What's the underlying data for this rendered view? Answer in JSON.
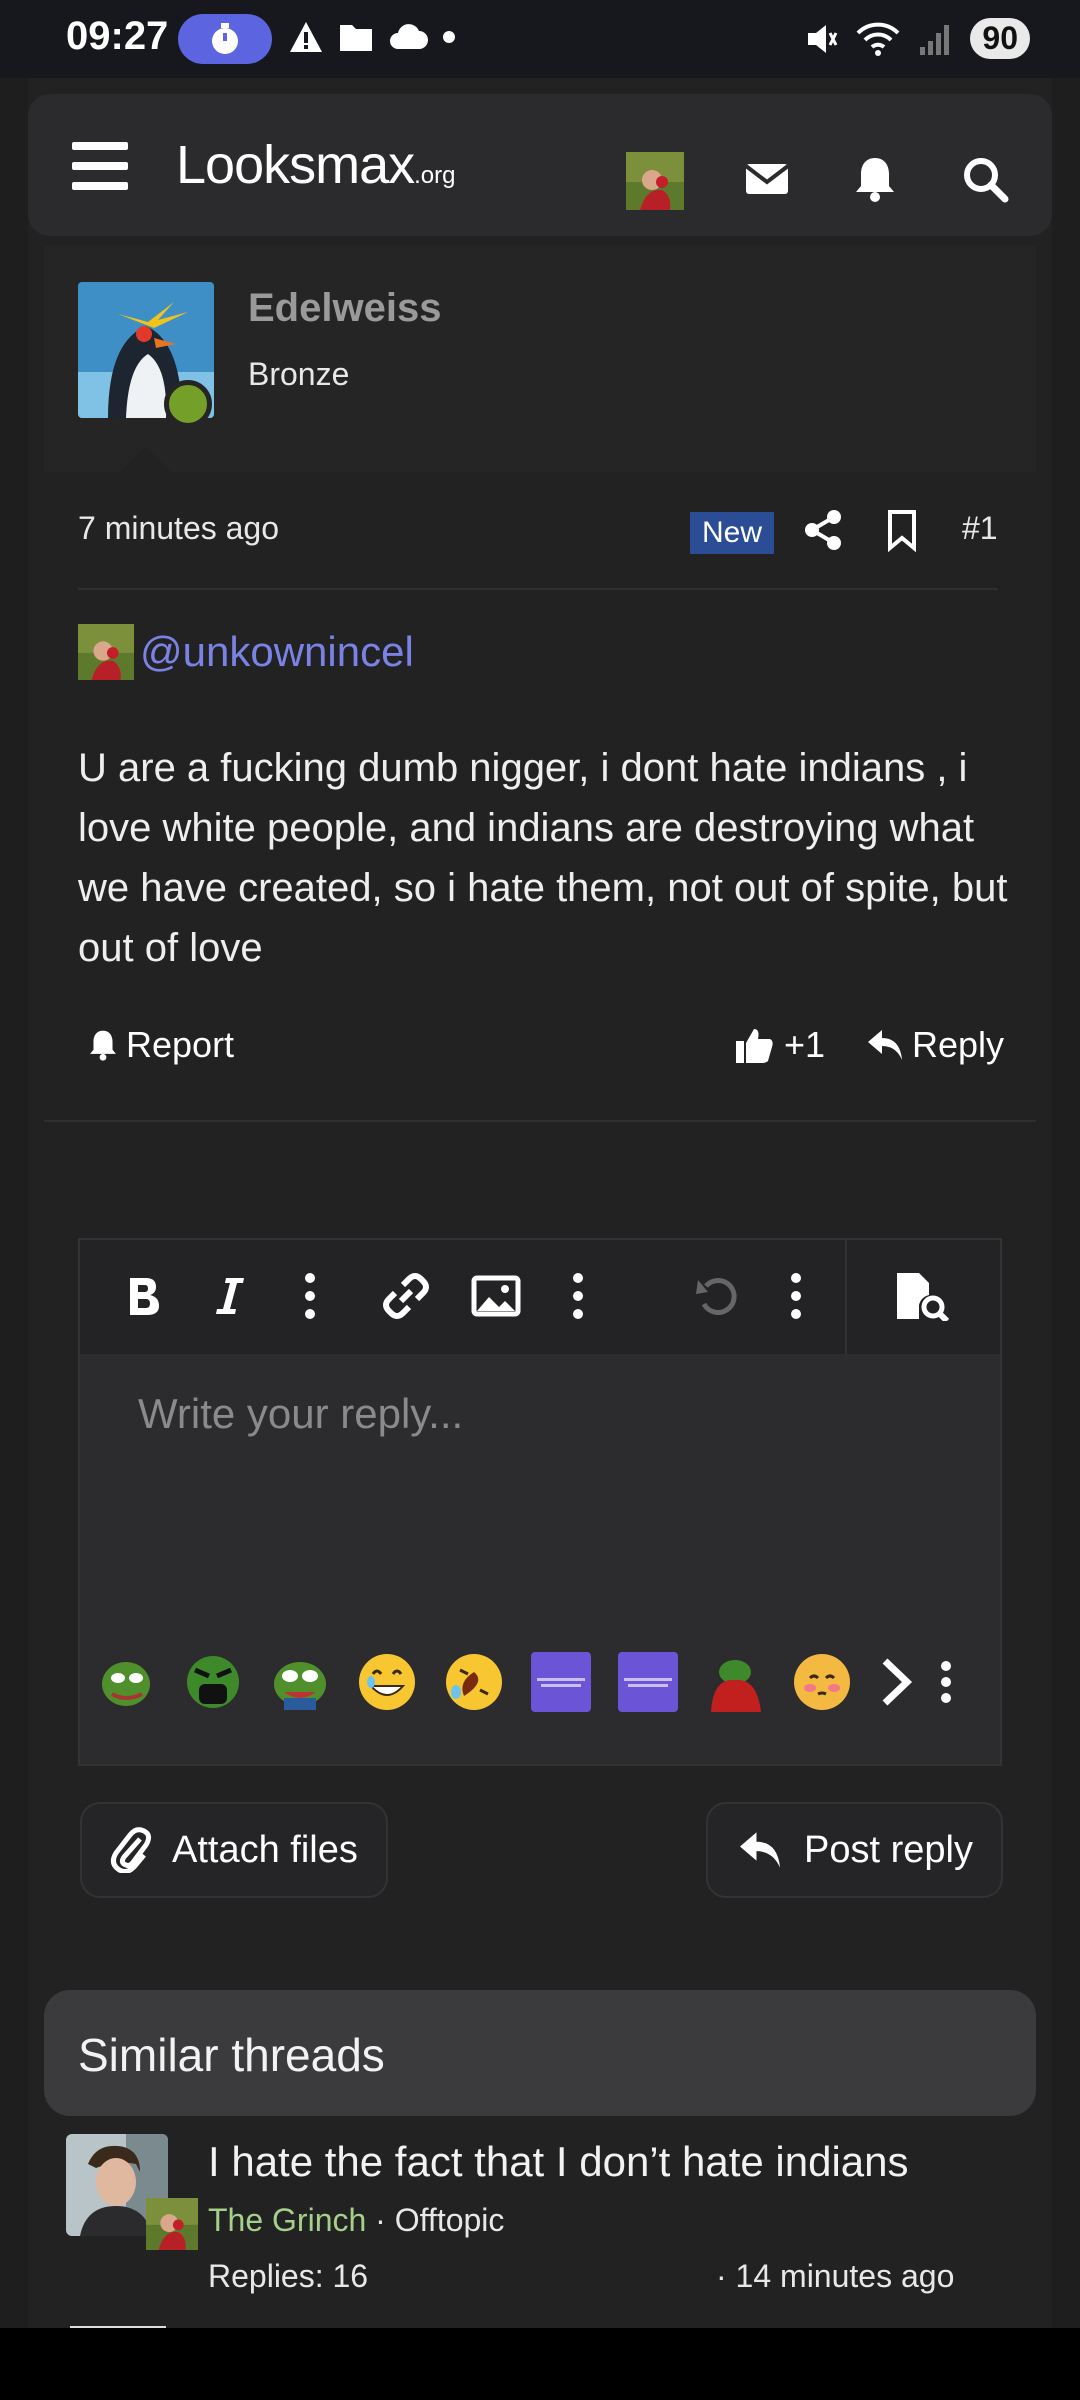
{
  "status_bar": {
    "time": "09:27",
    "battery": "90"
  },
  "header": {
    "logo_main": "Looksmax",
    "logo_suffix": ".org"
  },
  "post": {
    "author_name": "Edelweiss",
    "author_rank": "Bronze",
    "time": "7 minutes ago",
    "badge": "New",
    "post_number": "#1",
    "mention": "@unkownincel",
    "body": "U are a fucking dumb nigger, i dont hate indians , i love white people, and indians are destroying what we have created, so i hate them, not out of spite, but out of love",
    "report_label": "Report",
    "likes": "+1",
    "reply_label": "Reply"
  },
  "editor": {
    "placeholder": "Write your reply...",
    "attach_label": "Attach files",
    "post_reply_label": "Post reply"
  },
  "similar": {
    "title": "Similar threads",
    "threads": [
      {
        "title": "I hate the fact that I don’t hate indians",
        "user": "The Grinch",
        "separator": " · ",
        "forum": "Offtopic",
        "replies": "Replies: 16",
        "time": "· 14 minutes ago"
      }
    ]
  },
  "colors": {
    "accent": "#5c64e0",
    "mention": "#7a82e6",
    "online": "#74a02a",
    "badge_new": "#2a4d96",
    "thread_user": "#a4d08a"
  }
}
